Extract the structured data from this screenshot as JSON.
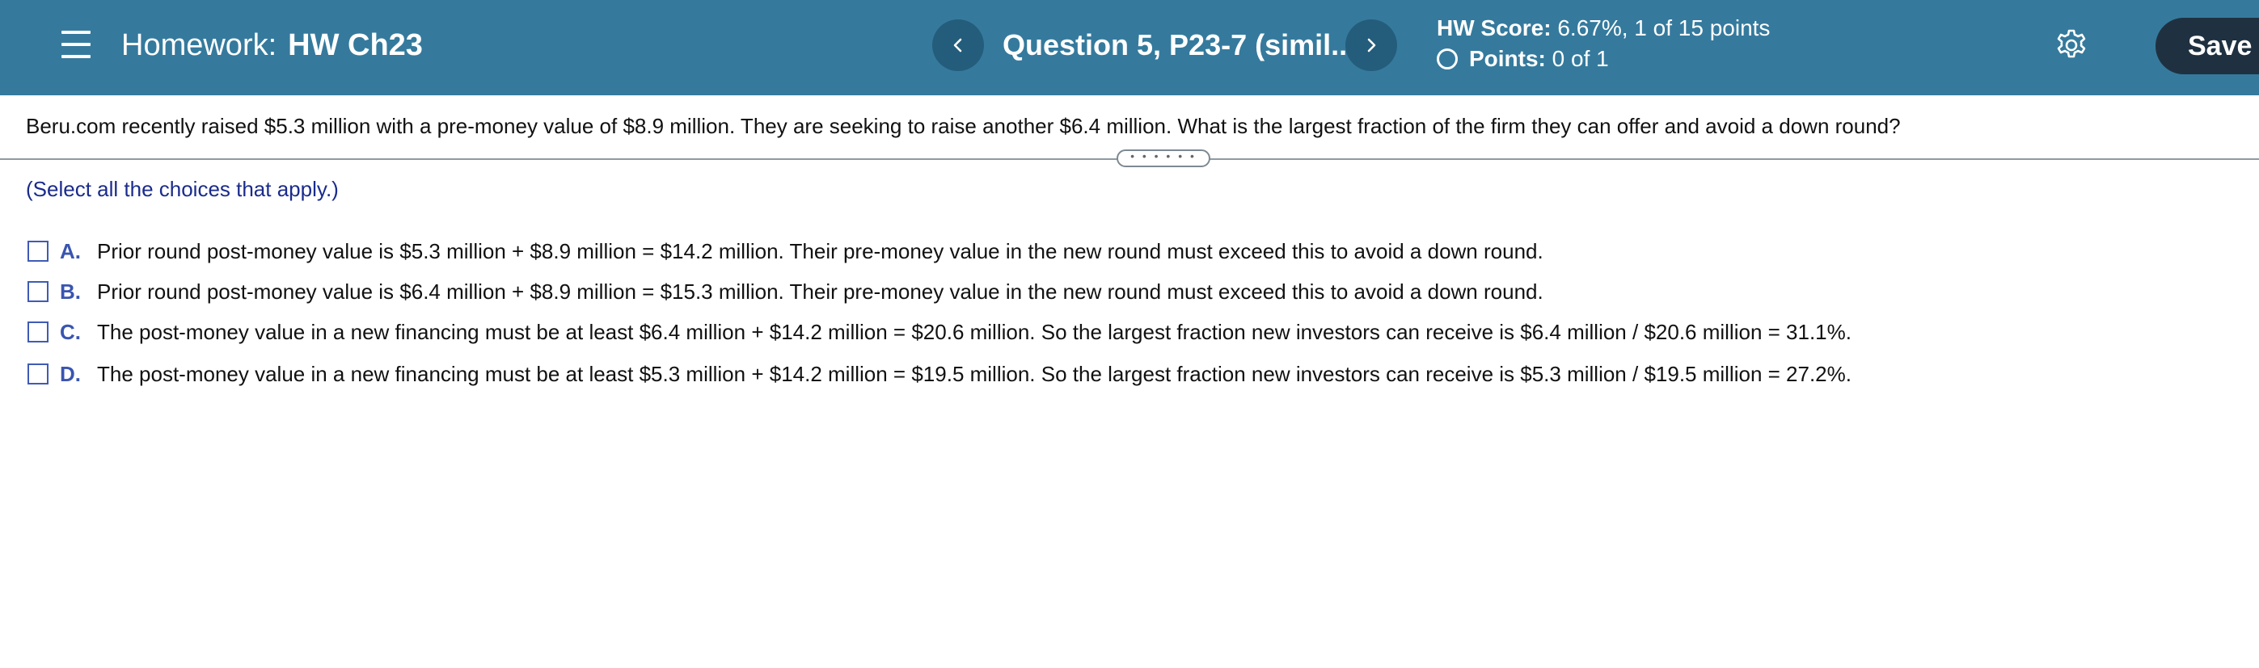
{
  "header": {
    "homework_label": "Homework:",
    "homework_name": "HW Ch23",
    "question_title": "Question 5, P23-7 (simil...",
    "hw_score_label": "HW Score:",
    "hw_score_value": "6.67%, 1 of 15 points",
    "points_label": "Points:",
    "points_value": "0 of 1",
    "save_label": "Save",
    "icons": {
      "menu": "hamburger-menu-icon",
      "prev": "chevron-left-icon",
      "next": "chevron-right-icon",
      "points_status": "empty-circle-icon",
      "settings": "gear-icon"
    }
  },
  "question": {
    "text": "Beru.com recently raised $5.3 million with a pre-money value of $8.9 million. They are seeking to raise another $6.4 million. What is the largest fraction of the firm they can offer and avoid a down round?",
    "instruction": "(Select all the choices that apply.)",
    "choices": [
      {
        "letter": "A.",
        "text": "Prior round post-money value is $5.3 million + $8.9 million = $14.2 million. Their pre-money value in the new round must exceed this to avoid a down round.",
        "checked": false
      },
      {
        "letter": "B.",
        "text": "Prior round post-money value is $6.4 million + $8.9 million = $15.3 million. Their pre-money value in the new round must exceed this to avoid a down round.",
        "checked": false
      },
      {
        "letter": "C.",
        "text": "The post-money value in a new financing must be at least $6.4 million + $14.2 million = $20.6 million. So the largest fraction new investors can receive is $6.4 million / $20.6 million = 31.1%.",
        "checked": false
      },
      {
        "letter": "D.",
        "text": "The post-money value in a new financing must be at least $5.3 million + $14.2 million = $19.5 million. So the largest fraction new investors can receive is $5.3 million / $19.5 million = 27.2%.",
        "checked": false
      }
    ]
  },
  "colors": {
    "header_bg": "#357a9d",
    "nav_button_bg": "#245d7b",
    "save_button_bg": "#1f3140",
    "choice_accent": "#3a55b0",
    "instruction_text": "#1a2b8c"
  }
}
